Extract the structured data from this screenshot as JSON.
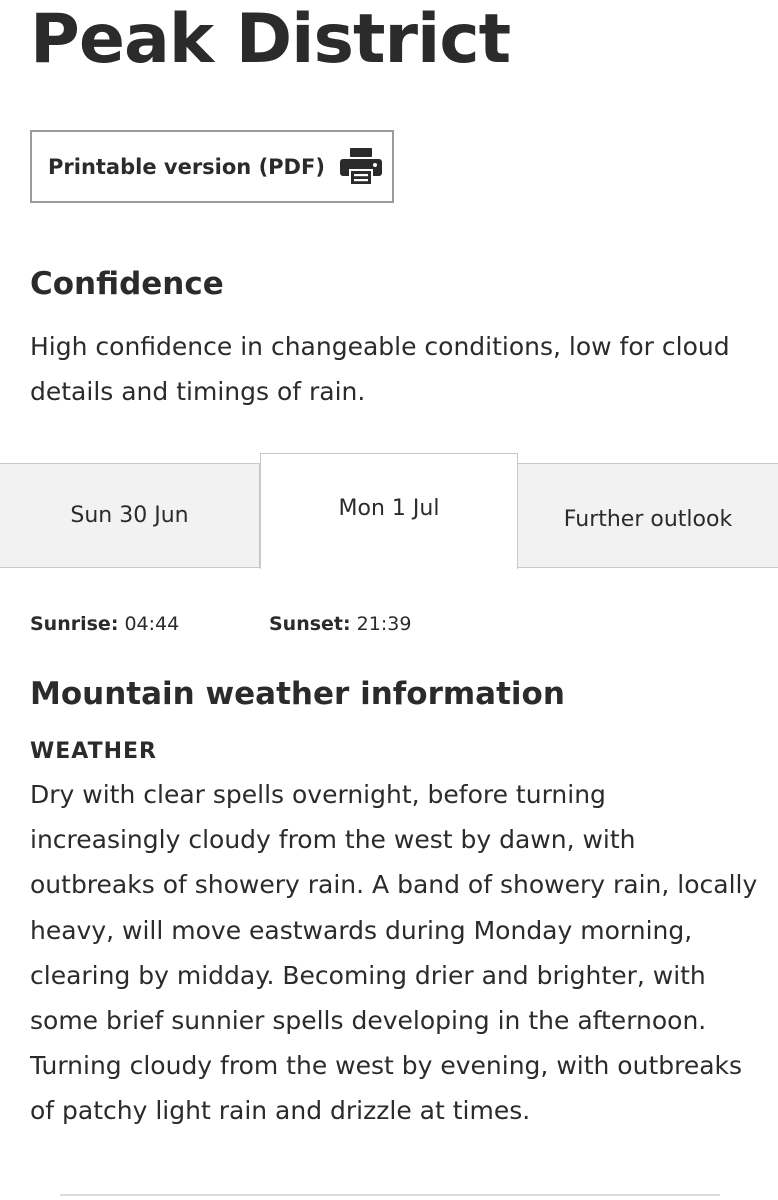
{
  "page": {
    "title": "Peak District"
  },
  "pdf_button": {
    "label": "Printable version (PDF)",
    "icon": "printer-icon"
  },
  "confidence": {
    "heading": "Confidence",
    "text": "High confidence in changeable conditions, low for cloud details and timings of rain."
  },
  "tabs": [
    {
      "label": "Sun 30 Jun",
      "selected": false
    },
    {
      "label": "Mon 1 Jul",
      "selected": true
    },
    {
      "label": "Further outlook",
      "selected": false
    }
  ],
  "sun": {
    "sunrise_label": "Sunrise:",
    "sunrise_time": "04:44",
    "sunset_label": "Sunset:",
    "sunset_time": "21:39"
  },
  "mountain": {
    "heading": "Mountain weather information",
    "weather_label": "WEATHER",
    "weather_text": "Dry with clear spells overnight, before turning increasingly cloudy from the west by dawn, with outbreaks of showery rain. A band of showery rain, locally heavy, will move eastwards during Monday morning, clearing by midday. Becoming drier and brighter, with some brief sunnier spells developing in the afternoon. Turning cloudy from the west by evening, with outbreaks of patchy light rain and drizzle at times."
  },
  "colors": {
    "text": "#2b2b2b",
    "tab_inactive_bg": "#f2f2f2",
    "tab_active_bg": "#ffffff",
    "border": "#c8c8c8"
  }
}
